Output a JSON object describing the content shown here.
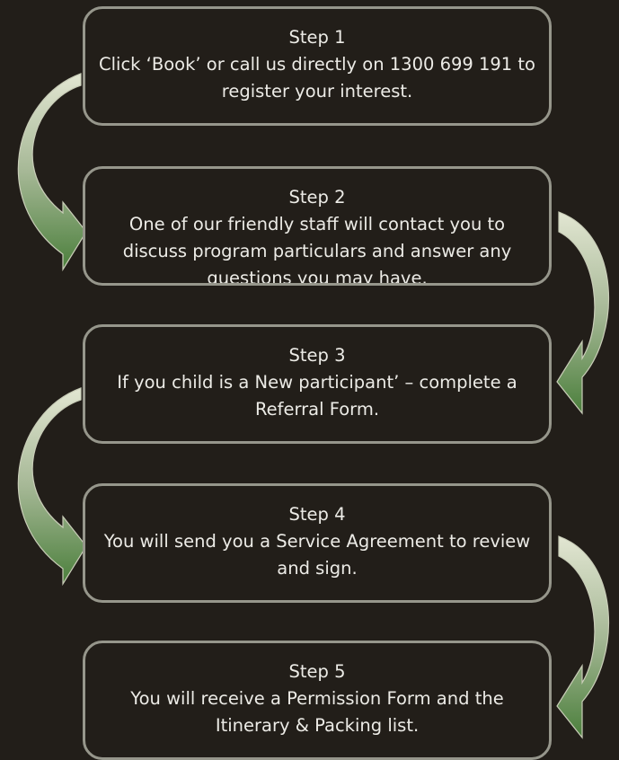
{
  "colors": {
    "background": "#221e19",
    "box_border": "#96968b",
    "text": "#ecebe6",
    "arrow_light": "#e2e6d2",
    "arrow_dark": "#4b7f3c"
  },
  "steps": [
    {
      "title": "Step 1",
      "body": "Click ‘Book’ or call us directly on 1300 699 191 to register your interest."
    },
    {
      "title": "Step 2",
      "body": "One of our friendly staff will contact you to discuss program particulars and answer any questions you may have."
    },
    {
      "title": "Step 3",
      "body": "If you child is a New participant’ – complete a Referral Form."
    },
    {
      "title": "Step 4",
      "body": "You will send you a Service Agreement to review and sign."
    },
    {
      "title": "Step 5",
      "body": "You will receive a Permission Form and the Itinerary & Packing list."
    }
  ],
  "arrows": [
    {
      "icon": "curved-arrow-left-icon",
      "from": "Step 1",
      "to": "Step 2"
    },
    {
      "icon": "curved-arrow-right-icon",
      "from": "Step 2",
      "to": "Step 3"
    },
    {
      "icon": "curved-arrow-left-icon",
      "from": "Step 3",
      "to": "Step 4"
    },
    {
      "icon": "curved-arrow-right-icon",
      "from": "Step 4",
      "to": "Step 5"
    }
  ]
}
